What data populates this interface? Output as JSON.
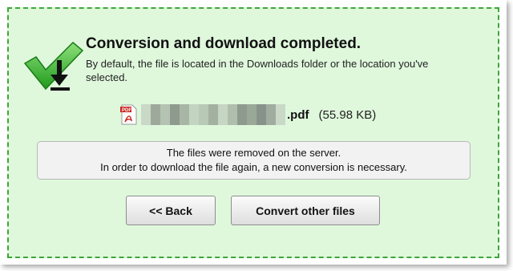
{
  "header": {
    "title": "Conversion and download completed.",
    "subtitle": "By default, the file is located in the Downloads folder or the location you've selected."
  },
  "file": {
    "icon": "pdf-file-icon",
    "extension": ".pdf",
    "size": "(55.98 KB)"
  },
  "notice": {
    "line1": "The files were removed on the server.",
    "line2": "In order to download the file again, a new conversion is necessary."
  },
  "buttons": {
    "back_label": "<< Back",
    "convert_label": "Convert other files"
  },
  "colors": {
    "panel_background": "#dff8dc",
    "panel_border": "#3ea63a",
    "check_green": "#2fb52b"
  }
}
